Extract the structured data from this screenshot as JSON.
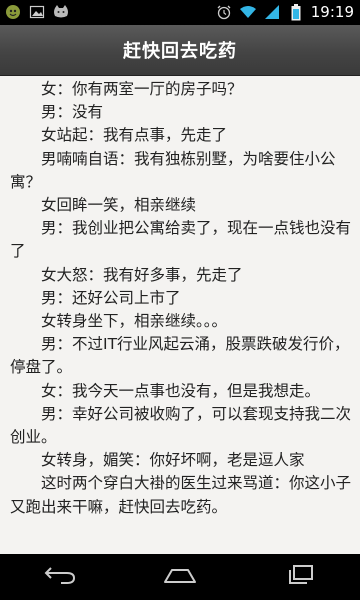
{
  "status_bar": {
    "time": "19:19",
    "left_icons": [
      "android-icon",
      "image-icon",
      "cat-icon"
    ],
    "right_icons": [
      "alarm-icon",
      "wifi-icon",
      "signal-icon",
      "battery-icon"
    ]
  },
  "header": {
    "title": "赶快回去吃药"
  },
  "story": {
    "paragraphs": [
      "女：你有两室一厅的房子吗？",
      "男：没有",
      "女站起：我有点事，先走了",
      "男喃喃自语：我有独栋别墅，为啥要住小公寓？",
      "女回眸一笑，相亲继续",
      "男：我创业把公寓给卖了，现在一点钱也没有了",
      "女大怒：我有好多事，先走了",
      "男：还好公司上市了",
      "女转身坐下，相亲继续。。。",
      "男：不过IT行业风起云涌，股票跌破发行价，停盘了。",
      "女：我今天一点事也没有，但是我想走。",
      "男：幸好公司被收购了，可以套现支持我二次创业。",
      "女转身，媚笑：你好坏啊，老是逗人家",
      "这时两个穿白大褂的医生过来骂道：你这小子又跑出来干嘛，赶快回去吃药。"
    ]
  },
  "nav_bar": {
    "buttons": [
      "back-icon",
      "home-icon",
      "recent-apps-icon"
    ]
  }
}
